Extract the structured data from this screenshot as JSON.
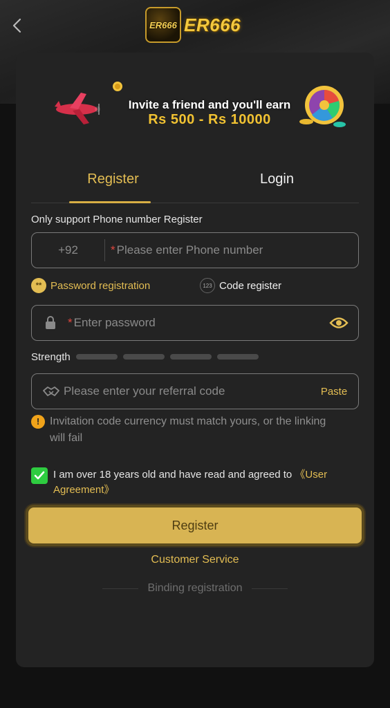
{
  "header": {
    "logo_badge_text": "ER666",
    "logo_text": "ER666"
  },
  "banner": {
    "line1": "Invite a friend and you'll earn",
    "line2": "Rs 500 - Rs 10000"
  },
  "tabs": [
    {
      "label": "Register",
      "active": true
    },
    {
      "label": "Login",
      "active": false
    }
  ],
  "form": {
    "hint": "Only support Phone number Register",
    "phone": {
      "country_code": "+92",
      "required_mark": "*",
      "placeholder": "Please enter Phone number",
      "value": ""
    },
    "modes": {
      "password_label": "Password registration",
      "password_icon": "**",
      "code_label": "Code register",
      "code_icon": "123"
    },
    "password": {
      "required_mark": "*",
      "placeholder": "Enter password",
      "value": ""
    },
    "strength_label": "Strength",
    "strength_level": 0,
    "referral": {
      "placeholder": "Please enter your referral code",
      "value": "",
      "paste_label": "Paste"
    },
    "warning": "Invitation code currency must match yours, or the linking will fail",
    "warning_icon": "!",
    "agreement": {
      "checked": true,
      "text": "I am over 18 years old and have read and agreed to ",
      "link": "《User Agreement》"
    },
    "submit_label": "Register"
  },
  "footer": {
    "customer_service": "Customer Service",
    "binding": "Binding registration"
  },
  "colors": {
    "accent": "#e3bd53",
    "button_bg": "#d8b453",
    "card_bg": "#232323",
    "check_green": "#2ecc40",
    "warning_orange": "#f0a31a"
  }
}
